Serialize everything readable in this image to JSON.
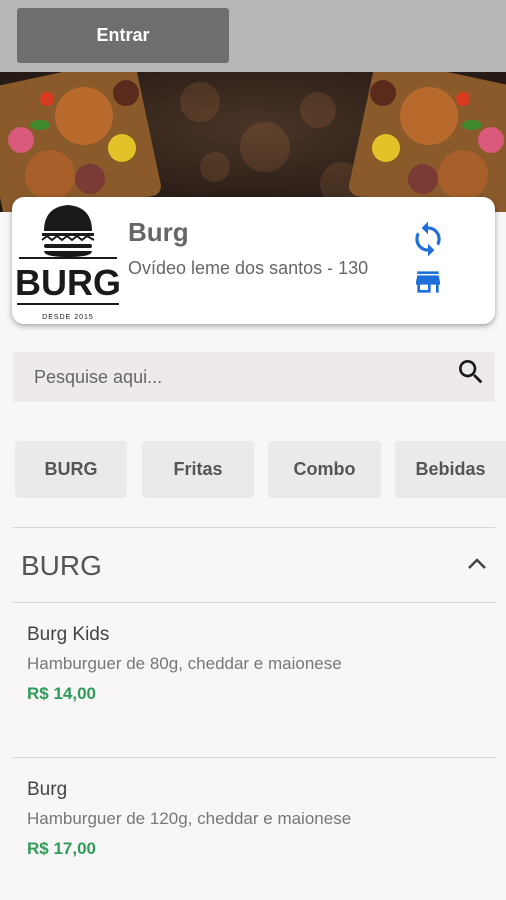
{
  "header": {
    "login_label": "Entrar"
  },
  "store": {
    "name": "Burg",
    "address": "Ovídeo leme dos santos - 130",
    "logo_text": "BURG",
    "logo_subtext": "DESDE 2015",
    "accent_color": "#1e6fd9",
    "refresh_icon": "refresh-icon",
    "store_icon": "storefront-icon"
  },
  "search": {
    "placeholder": "Pesquise aqui..."
  },
  "categories": [
    "BURG",
    "Fritas",
    "Combo",
    "Bebidas"
  ],
  "section": {
    "title": "BURG",
    "expanded": true
  },
  "products": [
    {
      "name": "Burg Kids",
      "description": "Hamburguer de 80g, cheddar e maionese",
      "price": "R$ 14,00"
    },
    {
      "name": "Burg",
      "description": "Hamburguer de 120g, cheddar e maionese",
      "price": "R$ 17,00"
    }
  ],
  "colors": {
    "price": "#2e9d5a",
    "topbar": "#b7b7b7",
    "button": "#6e6e6e"
  }
}
